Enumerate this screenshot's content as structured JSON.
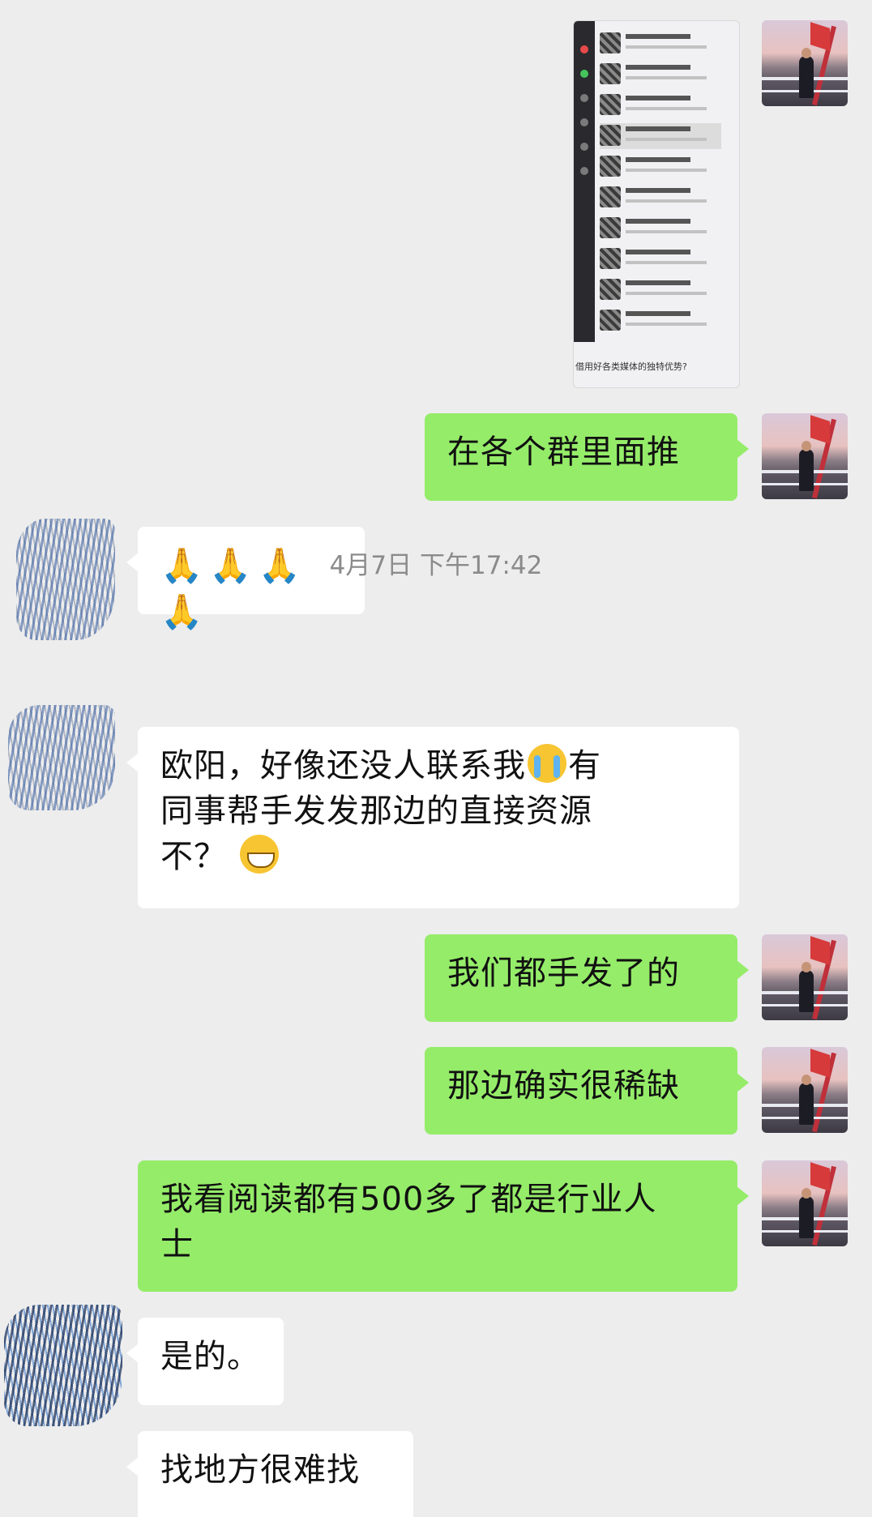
{
  "messages": [
    {
      "id": "m1",
      "side": "right",
      "type": "image",
      "description_icon": "chat-list-screenshot"
    },
    {
      "id": "m2",
      "side": "right",
      "type": "text",
      "text": "在各个群里面推"
    },
    {
      "id": "m3",
      "side": "left",
      "type": "emoji",
      "text": "🙏🙏🙏🙏"
    },
    {
      "id": "m4",
      "side": "left",
      "type": "text",
      "lines": [
        "欧阳，好像还没人联系我",
        "有",
        "同事帮手发发那边的直接资源",
        "不？"
      ]
    },
    {
      "id": "m5",
      "side": "right",
      "type": "text",
      "text": "我们都手发了的"
    },
    {
      "id": "m6",
      "side": "right",
      "type": "text",
      "text": "那边确实很稀缺"
    },
    {
      "id": "m7",
      "side": "right",
      "type": "text",
      "lines": [
        "我看阅读都有500多了都是行业人",
        "士"
      ]
    },
    {
      "id": "m8",
      "side": "left",
      "type": "text",
      "text": "是的。"
    },
    {
      "id": "m9",
      "side": "left",
      "type": "text",
      "text": "找地方很难找"
    }
  ],
  "timestamp": "4月7日 下午17:42",
  "screenshot_caption": "借用好各类媒体的独特优势?",
  "colors": {
    "background": "#ededed",
    "outgoing": "#95ec69",
    "incoming": "#ffffff",
    "timestamp": "#8b8b8b"
  }
}
